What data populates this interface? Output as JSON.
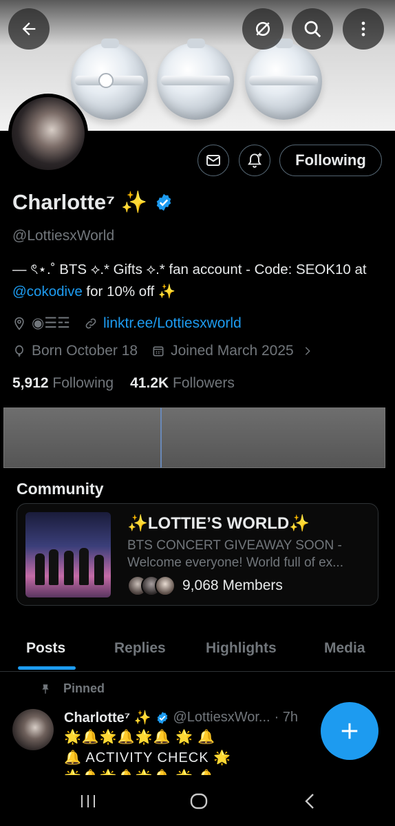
{
  "header": {
    "back_icon": "arrow-left-icon",
    "icons": [
      "no-sync-icon",
      "search-icon",
      "more-vertical-icon"
    ]
  },
  "profile": {
    "name": "Charlotte⁷ ✨",
    "verified": true,
    "handle": "@LottiesxWorld",
    "following_button": "Following",
    "bio_part1": "— ৎ⋆.˚ BTS ⟡.* Gifts ⟡.* fan account - Code: SEOK10 at ",
    "bio_link": "@cokodive",
    "bio_part2": " for 10% off ✨",
    "location": "◉☰☲",
    "website": "linktr.ee/Lottiesxworld",
    "born": "Born October 18",
    "joined": "Joined March 2025",
    "following_count": "5,912",
    "following_label": "Following",
    "followers_count": "41.2K",
    "followers_label": "Followers"
  },
  "community": {
    "section_title": "Community",
    "title": "✨LOTTIE’S WORLD✨",
    "desc_line1": "BTS CONCERT GIVEAWAY SOON -",
    "desc_line2": "Welcome everyone! World full of ex...",
    "members": "9,068 Members"
  },
  "tabs": [
    "Posts",
    "Replies",
    "Highlights",
    "Media"
  ],
  "post": {
    "pinned_label": "Pinned",
    "author": "Charlotte⁷ ✨",
    "handle": "@LottiesxWor...",
    "time": "· 7h",
    "line1": "🌟🔔🌟🔔🌟🔔 🌟 🔔",
    "line2": "🔔  ACTIVITY CHECK 🌟",
    "line3": "🌟🔔🌟🔔🌟🔔 🌟 🔔"
  },
  "colors": {
    "accent": "#1d9bf0",
    "muted": "#71767b",
    "text": "#e7e9ea",
    "border": "#2f3336"
  }
}
